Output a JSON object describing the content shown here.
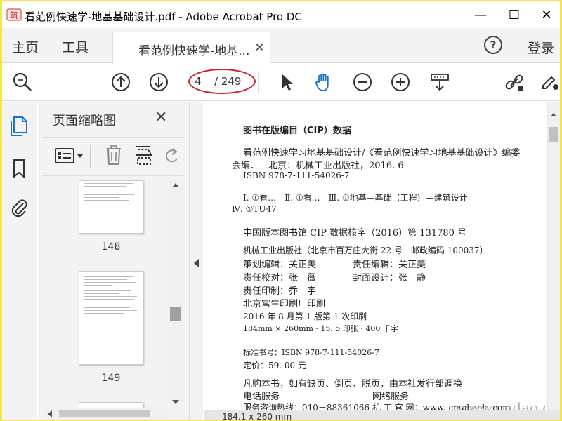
{
  "window": {
    "title": "看范例快速学-地基基础设计.pdf - Adobe Acrobat Pro DC",
    "minimize_glyph": "—",
    "maximize_glyph": "☐",
    "close_glyph": "✕",
    "logo_text": "筑"
  },
  "tabs": {
    "home": "主页",
    "tools": "工具",
    "document": "看范例快速学-地基...",
    "document_close": "✕",
    "help": "?",
    "login": "登录"
  },
  "toolbar": {
    "current_page": "4",
    "page_total": "/ 249",
    "icons": [
      "search-zoom-icon",
      "page-up-icon",
      "page-down-icon",
      "select-cursor-icon",
      "hand-tool-icon",
      "zoom-out-icon",
      "zoom-in-icon",
      "page-display-icon",
      "share-link-icon",
      "sign-icon"
    ],
    "accent_color": "#1a73c8",
    "annotation_color": "#d0202a"
  },
  "rail": {
    "icons": [
      "page-thumbnails-icon",
      "bookmarks-icon",
      "attachments-icon"
    ]
  },
  "thumbnails_panel": {
    "title": "页面缩略图",
    "close": "✕",
    "thumbnails": [
      {
        "label": "148"
      },
      {
        "label": "149"
      }
    ]
  },
  "document": {
    "lines": [
      "图书在版编目（CIP）数据",
      "看范例快速学习地基基础设计/《看范例快速学习地基基础设计》编委",
      "会编．—北京：机械工业出版社，2016. 6",
      "ISBN 978-7-111-54026-7",
      "Ⅰ. ①看…　Ⅱ. ①看…　Ⅲ. ①地基—基础（工程）—建筑设计",
      "Ⅳ. ①TU47",
      "中国版本图书馆 CIP 数据核字（2016）第 131780 号",
      "机械工业出版社（北京市百万庄大街 22 号　邮政编码 100037）",
      "策划编辑：关正美　　　　责任编辑：关正美",
      "责任校对：张　薇　　　　封面设计：张　静",
      "责任印制：乔　宇",
      "北京富生印刷厂印刷",
      "2016 年 8 月第 1 版第 1 次印刷",
      "184mm × 260mm · 15. 5 印张 · 400 千字",
      "标准书号：ISBN 978-7-111-54026-7",
      "定价：59. 00 元",
      "凡购本书，如有缺页、倒页、脱页，由本社发行部调换",
      "电话服务",
      "网络服务",
      "服务咨询热线：010－88361066",
      "机 工 官 网：www. cmpbook. com"
    ],
    "watermark": "www.cndao.com",
    "status": "184.1 x 260 mm"
  }
}
